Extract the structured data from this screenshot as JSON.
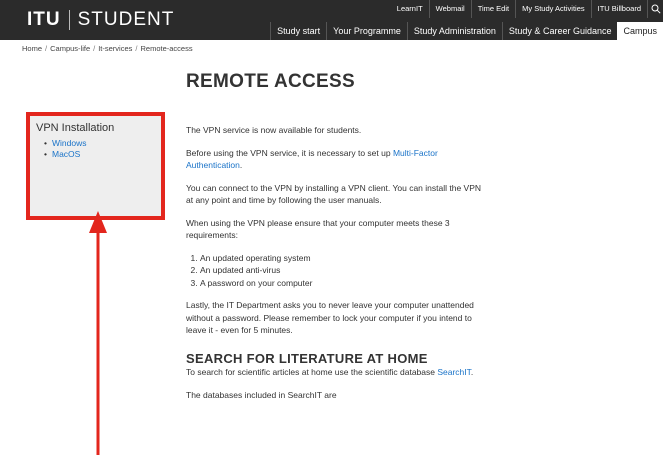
{
  "header": {
    "logo_main": "ITU",
    "logo_sub": "STUDENT",
    "top_links": [
      "LearnIT",
      "Webmail",
      "Time Edit",
      "My Study Activities",
      "ITU Billboard"
    ],
    "nav": [
      "Study start",
      "Your Programme",
      "Study Administration",
      "Study & Career Guidance",
      "Campus"
    ],
    "active_nav": "Campus"
  },
  "breadcrumb": [
    "Home",
    "Campus-life",
    "It-services",
    "Remote-access"
  ],
  "page_title": "REMOTE ACCESS",
  "sidebar": {
    "title": "VPN Installation",
    "items": [
      "Windows",
      "MacOS"
    ],
    "highlight_color": "#e3261d"
  },
  "content": {
    "p1": "The VPN service is now available for students.",
    "p2_prefix": "Before using the VPN service, it is necessary to set up ",
    "p2_link": "Multi-Factor Authentication",
    "p2_suffix": ".",
    "p3": "You can connect to the VPN by installing a VPN client. You can install the VPN at any point and time by following the user manuals.",
    "p4": "When using the VPN please ensure that your computer meets these 3 requirements:",
    "requirements": [
      "An updated operating system",
      "An updated anti-virus",
      "A password on your computer"
    ],
    "p5": "Lastly, the IT Department asks you to never leave your computer unattended without a password. Please remember to lock your computer if you intend to leave it - even for 5 minutes.",
    "section_title": "SEARCH FOR LITERATURE AT HOME",
    "p6_prefix": "To search for scientific articles at home use the scientific database ",
    "p6_link": "SearchIT",
    "p6_suffix": ".",
    "p7": "The databases included in SearchIT are"
  },
  "colors": {
    "header_bg": "#2b2b2b",
    "link": "#1a73c8",
    "annotation_red": "#e3261d"
  },
  "icons": {
    "search": "search-icon",
    "arrow": "arrow-up-icon"
  }
}
